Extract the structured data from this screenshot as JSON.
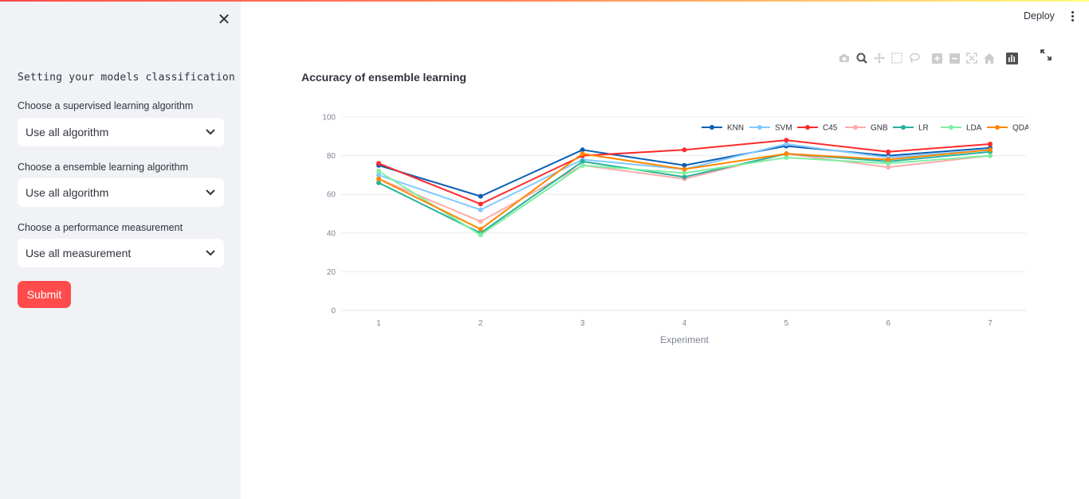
{
  "sidebar": {
    "heading": "Setting your models classification",
    "fields": [
      {
        "label": "Choose a supervised learning algorithm",
        "value": "Use all algorithm"
      },
      {
        "label": "Choose a ensemble learning algorithm",
        "value": "Use all algorithm"
      },
      {
        "label": "Choose a performance measurement",
        "value": "Use all measurement"
      }
    ],
    "submit_label": "Submit"
  },
  "header": {
    "deploy_label": "Deploy"
  },
  "toolbar_icons": [
    "camera-icon",
    "zoom-icon",
    "pan-icon",
    "box-select-icon",
    "lasso-icon",
    "zoom-in-icon",
    "zoom-out-icon",
    "autoscale-icon",
    "home-icon",
    "plotly-logo-icon"
  ],
  "chart_data": {
    "type": "line",
    "title": "Accuracy of ensemble learning",
    "xlabel": "Experiment",
    "ylabel": "",
    "x": [
      1,
      2,
      3,
      4,
      5,
      6,
      7
    ],
    "ylim": [
      0,
      100
    ],
    "yticks": [
      0,
      20,
      40,
      60,
      80,
      100
    ],
    "grid": true,
    "legend_position": "top-right",
    "series": [
      {
        "name": "KNN",
        "color": "#0b5fb4",
        "values": [
          75,
          59,
          83,
          75,
          85,
          80,
          84
        ]
      },
      {
        "name": "SVM",
        "color": "#83c9ff",
        "values": [
          70,
          52,
          78,
          73,
          86,
          79,
          83
        ]
      },
      {
        "name": "C45",
        "color": "#ff2b2b",
        "values": [
          76,
          55,
          80,
          83,
          88,
          82,
          86
        ]
      },
      {
        "name": "GNB",
        "color": "#ffabab",
        "values": [
          68,
          46,
          75,
          68,
          81,
          74,
          80
        ]
      },
      {
        "name": "LR",
        "color": "#29b09d",
        "values": [
          66,
          40,
          77,
          69,
          81,
          77,
          82
        ]
      },
      {
        "name": "LDA",
        "color": "#7defa1",
        "values": [
          72,
          39,
          75,
          71,
          79,
          76,
          80
        ]
      },
      {
        "name": "QDA",
        "color": "#ff8700",
        "values": [
          68,
          42,
          81,
          73,
          81,
          78,
          83
        ]
      }
    ]
  }
}
